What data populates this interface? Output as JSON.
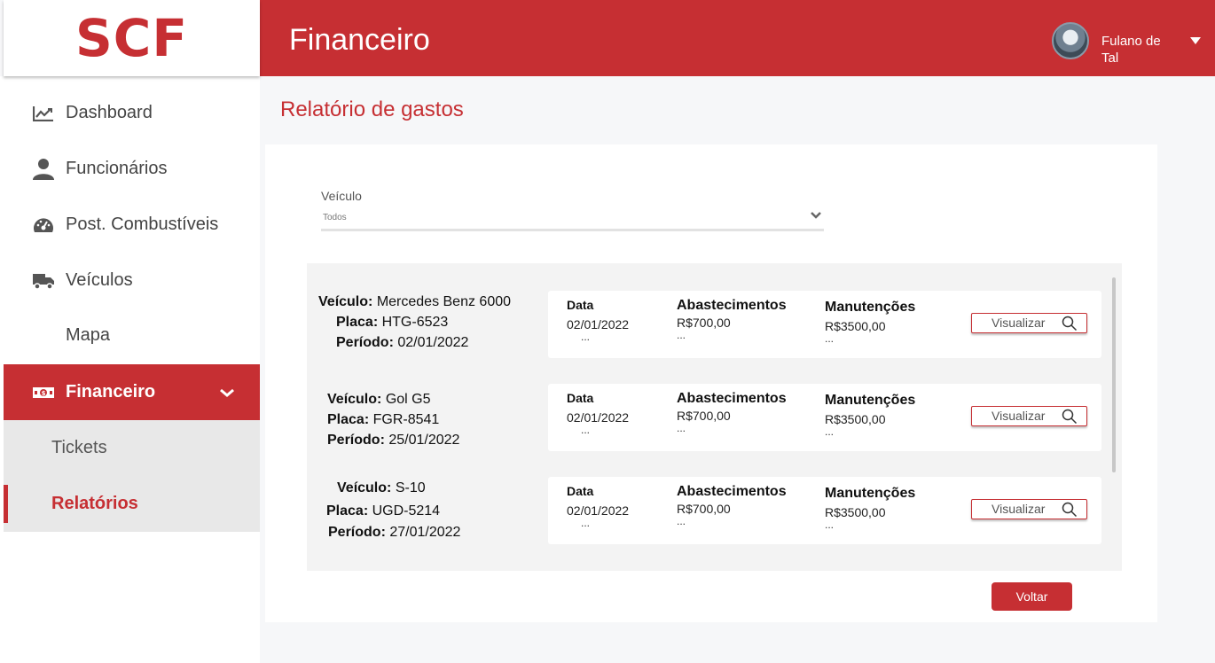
{
  "app": {
    "logo": "SCF"
  },
  "header": {
    "title": "Financeiro",
    "user_name": "Fulano de Tal",
    "user_caret_icon": "caret-down-icon"
  },
  "sidebar": {
    "items": [
      {
        "label": "Dashboard",
        "icon": "chart-line-icon"
      },
      {
        "label": "Funcionários",
        "icon": "user-icon"
      },
      {
        "label": "Post. Combustíveis",
        "icon": "gauge-icon"
      },
      {
        "label": "Veículos",
        "icon": "truck-icon"
      },
      {
        "label": "Mapa",
        "icon": ""
      },
      {
        "label": "Financeiro",
        "icon": "money-icon",
        "active": true,
        "expanded": true
      }
    ],
    "sub_items": [
      {
        "label": "Tickets"
      },
      {
        "label": "Relatórios",
        "active": true
      }
    ]
  },
  "main": {
    "page_title": "Relatório de gastos",
    "filter": {
      "label": "Veículo",
      "value": "Todos"
    },
    "columns": {
      "date": "Data",
      "fuel": "Abastecimentos",
      "maint": "Manutenções"
    },
    "labels": {
      "vehicle": "Veículo:",
      "plate": "Placa:",
      "period": "Período:"
    },
    "rows": [
      {
        "vehicle": "Mercedes Benz 6000",
        "plate": "HTG-6523",
        "period": "02/01/2022",
        "date": "02/01/2022",
        "fuel": "R$700,00",
        "maint": "R$3500,00",
        "more": "...",
        "button": "Visualizar"
      },
      {
        "vehicle": "Gol G5",
        "plate": "FGR-8541",
        "period": "25/01/2022",
        "date": "02/01/2022",
        "fuel": "R$700,00",
        "maint": "R$3500,00",
        "more": "...",
        "button": "Visualizar"
      },
      {
        "vehicle": "S-10",
        "plate": "UGD-5214",
        "period": "27/01/2022",
        "date": "02/01/2022",
        "fuel": "R$700,00",
        "maint": "R$3500,00",
        "more": "...",
        "button": "Visualizar"
      }
    ],
    "back_button": "Voltar"
  },
  "colors": {
    "brand": "#c62f33",
    "sidebar_sub_bg": "#e8e8e8",
    "list_bg": "#f3f3f3"
  }
}
